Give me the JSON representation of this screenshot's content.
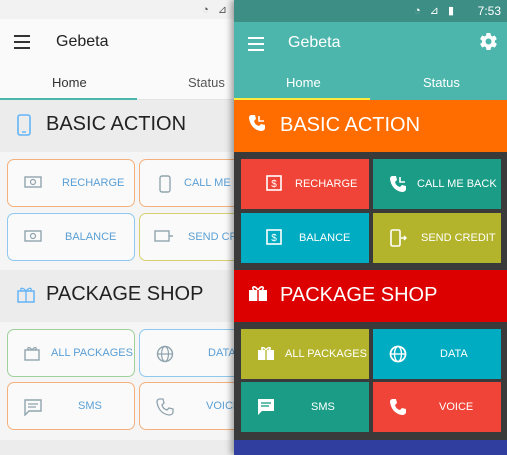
{
  "left": {
    "status_icons": "◔ ⊿",
    "app_title": "Gebeta",
    "tabs": [
      {
        "label": "Home"
      },
      {
        "label": "Status"
      }
    ],
    "sections": [
      {
        "title": "BASIC ACTION",
        "icon": "phone-icon"
      },
      {
        "title": "PACKAGE SHOP",
        "icon": "gift-icon"
      }
    ],
    "buttons": [
      {
        "label": "RECHARGE",
        "icon": "money-icon"
      },
      {
        "label": "CALL ME B",
        "icon": "phone-icon"
      },
      {
        "label": "BALANCE",
        "icon": "money-icon"
      },
      {
        "label": "SEND CRED",
        "icon": "send-credit-icon"
      },
      {
        "label": "ALL PACKAGES",
        "icon": "gift-icon"
      },
      {
        "label": "DATA",
        "icon": "globe-icon"
      },
      {
        "label": "SMS",
        "icon": "message-icon"
      },
      {
        "label": "VOICE",
        "icon": "phone-icon"
      }
    ]
  },
  "right": {
    "status_icons": "◔ ⊿ ▮",
    "time": "7:53",
    "app_title": "Gebeta",
    "tabs": [
      {
        "label": "Home"
      },
      {
        "label": "Status"
      }
    ],
    "sections": [
      {
        "title": "BASIC ACTION",
        "icon": "phone-icon"
      },
      {
        "title": "PACKAGE SHOP",
        "icon": "gift-icon"
      }
    ],
    "buttons": [
      {
        "label": "RECHARGE",
        "icon": "money-icon"
      },
      {
        "label": "CALL ME BACK",
        "icon": "phone-callback-icon"
      },
      {
        "label": "BALANCE",
        "icon": "money-icon"
      },
      {
        "label": "SEND CREDIT",
        "icon": "send-credit-icon"
      },
      {
        "label": "ALL PACKAGES",
        "icon": "gift-icon"
      },
      {
        "label": "DATA",
        "icon": "globe-icon"
      },
      {
        "label": "SMS",
        "icon": "message-icon"
      },
      {
        "label": "VOICE",
        "icon": "phone-icon"
      }
    ]
  },
  "colors": {
    "teal": "#4db6ac",
    "orange": "#ff6d00",
    "red": "#dd0000",
    "tab_indicator": "#ffeb3b"
  }
}
